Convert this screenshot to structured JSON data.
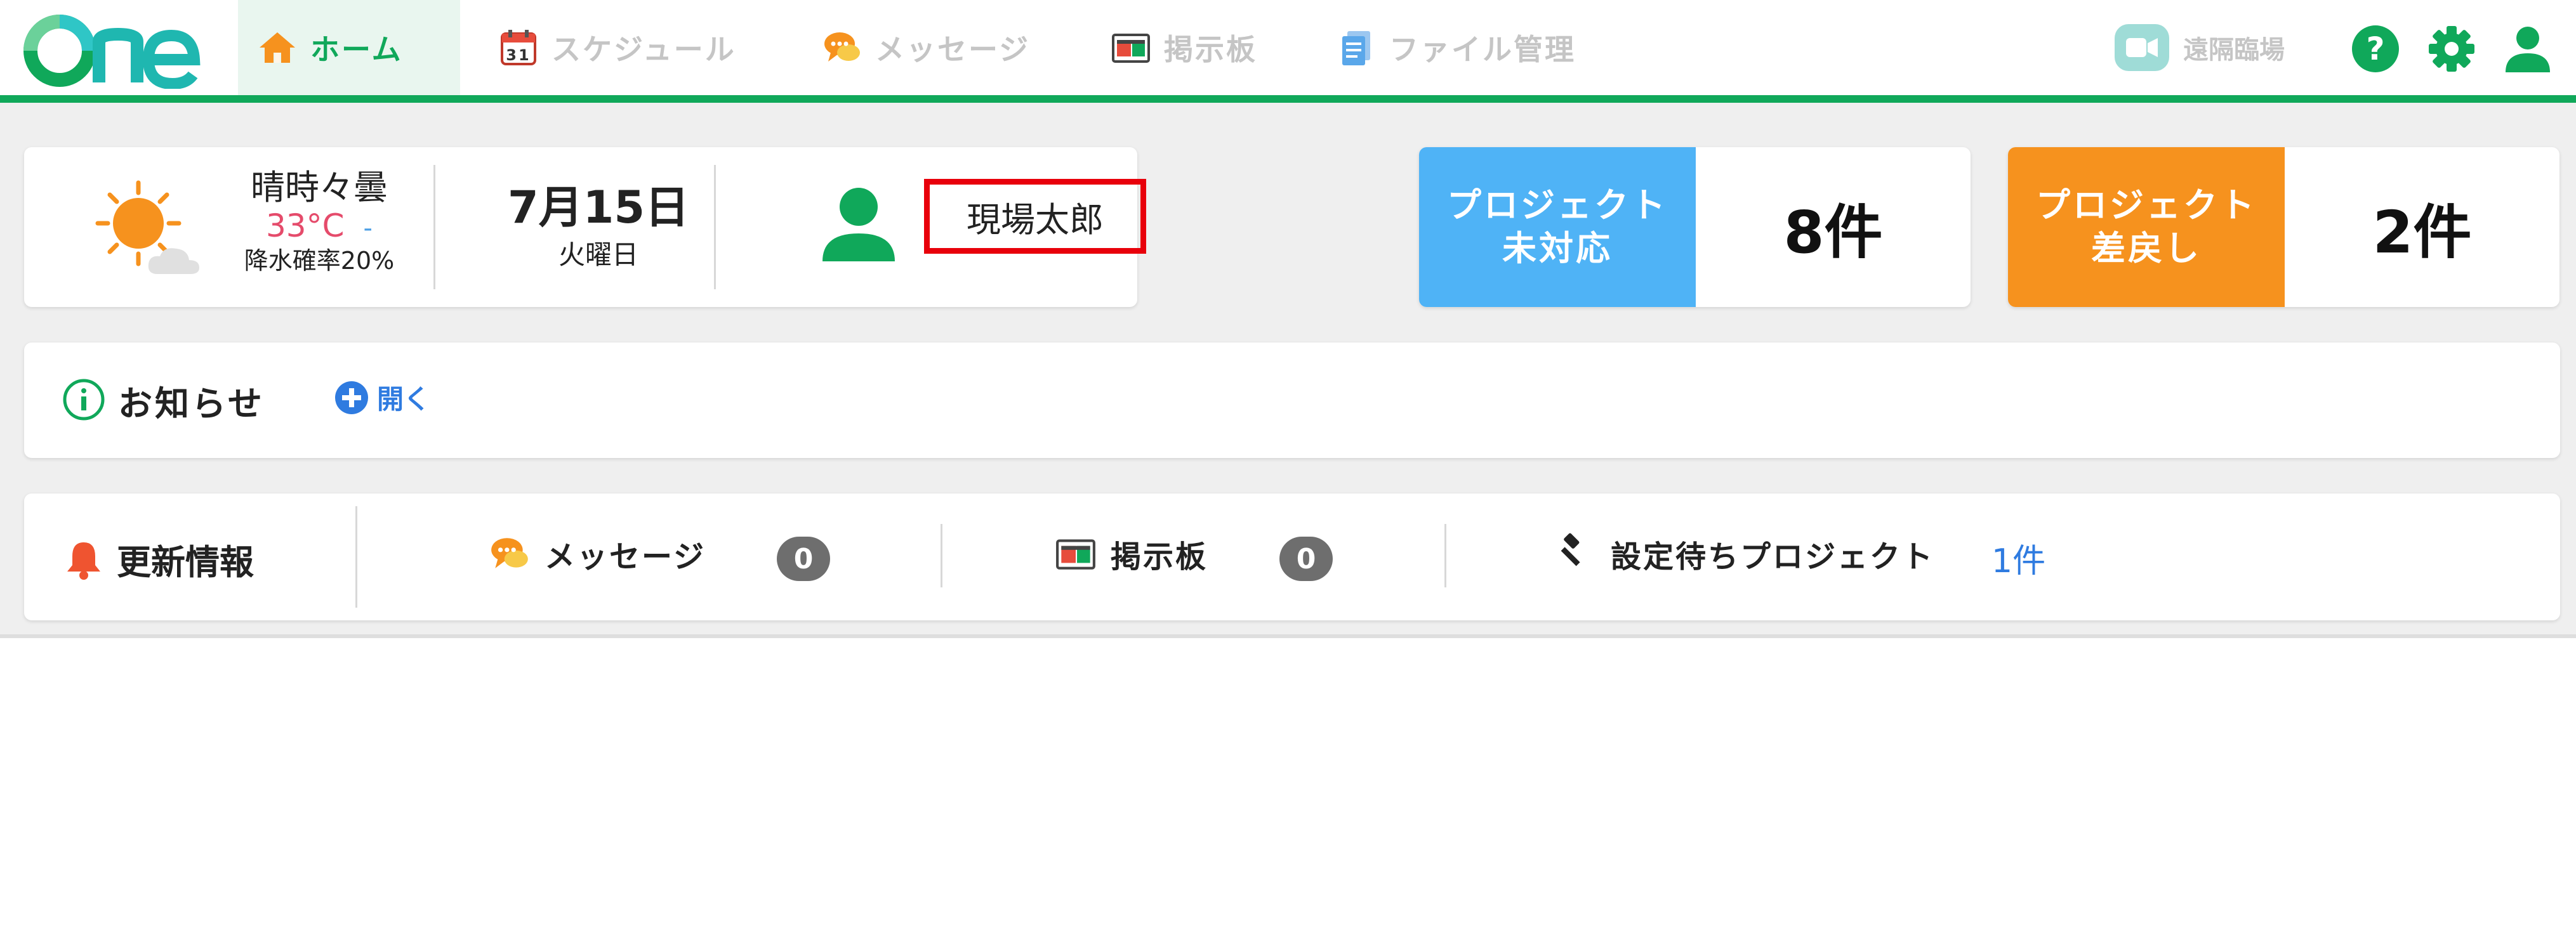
{
  "header": {
    "logo_text": "One",
    "nav": [
      {
        "label": "ホーム",
        "icon": "home-icon",
        "active": true
      },
      {
        "label": "スケジュール",
        "icon": "calendar-icon",
        "calendar_day": "31"
      },
      {
        "label": "メッセージ",
        "icon": "message-icon"
      },
      {
        "label": "掲示板",
        "icon": "bulletin-board-icon"
      },
      {
        "label": "ファイル管理",
        "icon": "files-icon"
      }
    ],
    "remote_label": "遠隔臨場",
    "icons": [
      "help-icon",
      "settings-icon",
      "user-icon"
    ]
  },
  "info": {
    "weather_condition": "晴時々曇",
    "temperature": "33°C",
    "temperature_low": "-",
    "rain_chance": "降水確率20%",
    "date": "7月15日",
    "weekday": "火曜日",
    "user_name": "現場太郎"
  },
  "stats": [
    {
      "label_line1": "プロジェクト",
      "label_line2": "未対応",
      "value": "8件",
      "color": "#4fb3f6"
    },
    {
      "label_line1": "プロジェクト",
      "label_line2": "差戻し",
      "value": "2件",
      "color": "#f6921e"
    }
  ],
  "notice": {
    "title": "お知らせ",
    "open_label": "開く"
  },
  "updates": {
    "title": "更新情報",
    "message_label": "メッセージ",
    "message_count": "0",
    "board_label": "掲示板",
    "board_count": "0",
    "pending_label": "設定待ちプロジェクト",
    "pending_count": "1件"
  },
  "colors": {
    "brand_green": "#10a85a",
    "link_blue": "#2f7be0",
    "highlight_red": "#e8000b"
  }
}
